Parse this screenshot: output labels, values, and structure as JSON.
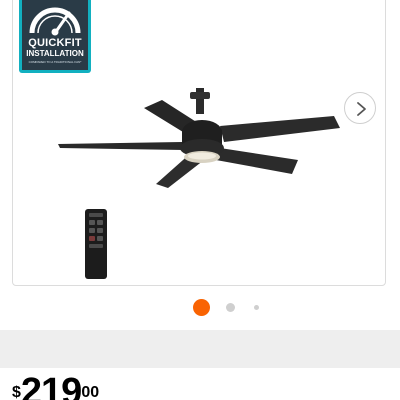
{
  "badge": {
    "title": "QUICKFIT",
    "subtitle": "INSTALLATION",
    "fine_print": "COMPARED TO A TRADITIONAL FAN*"
  },
  "gallery": {
    "dots_count": 3,
    "active_index": 0,
    "accent_color": "#f96302"
  },
  "price": {
    "symbol": "$",
    "dollars": "219",
    "cents": "00"
  },
  "icons": {
    "next": "chevron-right-icon"
  }
}
